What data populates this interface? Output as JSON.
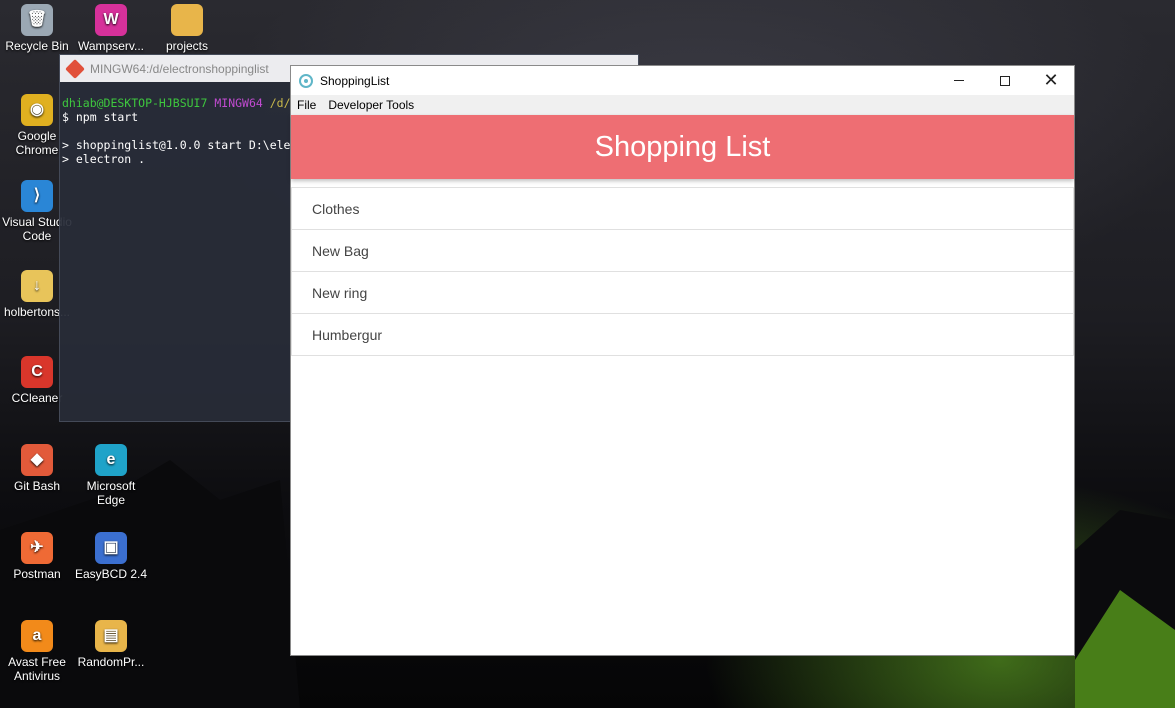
{
  "desktop": {
    "icons": [
      {
        "label": "Recycle Bin",
        "icon": "recycle-bin-icon",
        "color": "#9ba8b4",
        "glyph": "🗑"
      },
      {
        "label": "Wampserv...",
        "icon": "wampserver-icon",
        "color": "#d6319a",
        "glyph": "W"
      },
      {
        "label": "projects",
        "icon": "folder-icon",
        "color": "#e8b54a",
        "glyph": ""
      },
      {
        "label": "Google\nChrome",
        "icon": "chrome-icon",
        "color": "#e0b020",
        "glyph": "◉"
      },
      {
        "label": "Visual Studio\nCode",
        "icon": "vscode-icon",
        "color": "#2a86d6",
        "glyph": "⟩"
      },
      {
        "label": "holbertons...",
        "icon": "folder-icon",
        "color": "#e8c45a",
        "glyph": "↓"
      },
      {
        "label": "CCleaner",
        "icon": "ccleaner-icon",
        "color": "#d9362b",
        "glyph": "C"
      },
      {
        "label": "Git Bash",
        "icon": "git-bash-icon",
        "color": "#e25a3a",
        "glyph": "◆"
      },
      {
        "label": "Microsoft\nEdge",
        "icon": "edge-icon",
        "color": "#1fa3c9",
        "glyph": "e"
      },
      {
        "label": "Postman",
        "icon": "postman-icon",
        "color": "#ef6a35",
        "glyph": "✈"
      },
      {
        "label": "EasyBCD 2.4",
        "icon": "easybcd-icon",
        "color": "#3b6fd0",
        "glyph": "▣"
      },
      {
        "label": "Avast Free\nAntivirus",
        "icon": "avast-icon",
        "color": "#f28a1a",
        "glyph": "a"
      },
      {
        "label": "RandomPr...",
        "icon": "randomprogram-icon",
        "color": "#e8b54a",
        "glyph": "▤"
      }
    ]
  },
  "terminal": {
    "title": "MINGW64:/d/electronshoppinglist",
    "prompt_user": "dhiab@DESKTOP-HJBSUI7",
    "prompt_sys": "MINGW64",
    "prompt_path": "/d/",
    "command": "$ npm start",
    "output1": "> shoppinglist@1.0.0 start D:\\ele",
    "output2": "> electron ."
  },
  "app": {
    "title": "ShoppingList",
    "menu": [
      "File",
      "Developer Tools"
    ],
    "header": "Shopping List",
    "items": [
      "Clothes",
      "New Bag",
      "New ring",
      "Humbergur"
    ],
    "colors": {
      "header": "#ee6e73"
    }
  }
}
